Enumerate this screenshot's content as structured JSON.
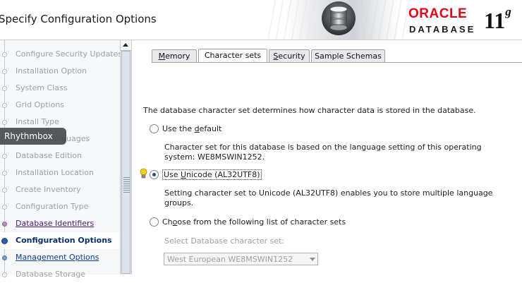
{
  "header": {
    "title": "Specify Configuration Options",
    "logo_brand": "ORACLE",
    "logo_product": "DATABASE",
    "logo_version": "11",
    "logo_version_sup": "g"
  },
  "nav": {
    "items": [
      {
        "label": "Configure Security Updates",
        "state": "disabled"
      },
      {
        "label": "Installation Option",
        "state": "disabled"
      },
      {
        "label": "System Class",
        "state": "disabled"
      },
      {
        "label": "Grid Options",
        "state": "disabled"
      },
      {
        "label": "Install Type",
        "state": "disabled"
      },
      {
        "label": "Product Languages",
        "state": "disabled"
      },
      {
        "label": "Database Edition",
        "state": "disabled"
      },
      {
        "label": "Installation Location",
        "state": "disabled"
      },
      {
        "label": "Create Inventory",
        "state": "disabled"
      },
      {
        "label": "Configuration Type",
        "state": "disabled"
      },
      {
        "label": "Database Identifiers",
        "state": "visited"
      },
      {
        "label": "Configuration Options",
        "state": "current"
      },
      {
        "label": "Management Options",
        "state": "link"
      },
      {
        "label": "Database Storage",
        "state": "disabled"
      }
    ]
  },
  "tooltip": {
    "text": "Rhythmbox"
  },
  "tabs": [
    {
      "label": "Memory",
      "mnemonic": "M",
      "rest": "emory",
      "active": false
    },
    {
      "label": "Character sets",
      "mnemonic": "",
      "rest": "Character sets",
      "active": true
    },
    {
      "label": "Security",
      "mnemonic": "S",
      "rest": "ecurity",
      "active": false
    },
    {
      "label": "Sample Schemas",
      "mnemonic": "",
      "rest": "Sample Schemas",
      "active": false
    }
  ],
  "charset": {
    "description": "The database character set determines how character data is stored in the database.",
    "options": [
      {
        "label_pre": "Use the ",
        "mnemonic": "d",
        "label_post": "efault",
        "selected": false,
        "help": "Character set for this database is based on the language setting of this operating system: WE8MSWIN1252."
      },
      {
        "label_pre": "Use ",
        "mnemonic": "U",
        "label_post": "nicode (AL32UTF8)",
        "selected": true,
        "help": "Setting character set to Unicode (AL32UTF8) enables you to store multiple language groups."
      },
      {
        "label_pre": "Ch",
        "mnemonic": "o",
        "label_post": "ose from the following list of character sets",
        "selected": false,
        "help": ""
      }
    ],
    "select_label": "Select Database character set:",
    "select_value": "West European WE8MSWIN1252"
  },
  "colors": {
    "accent": "#2f5da3",
    "brand_red": "#e2001a",
    "visited": "#4a1a6a"
  }
}
